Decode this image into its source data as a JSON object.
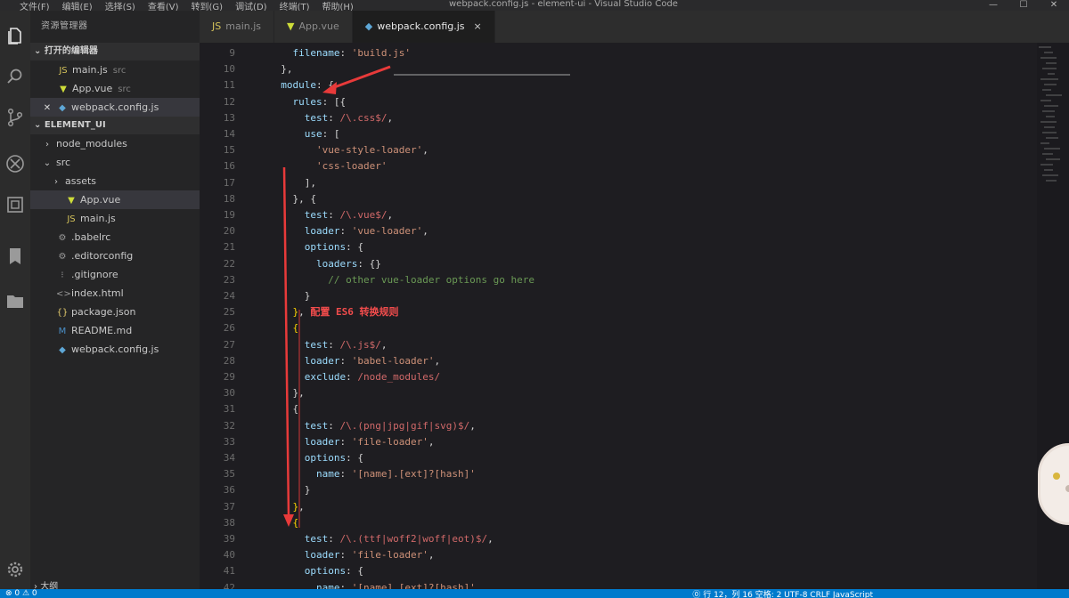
{
  "window": {
    "title": "webpack.config.js - element-ui - Visual Studio Code",
    "controls": [
      "—",
      "☐",
      "✕"
    ]
  },
  "menu": [
    "文件(F)",
    "编辑(E)",
    "选择(S)",
    "查看(V)",
    "转到(G)",
    "调试(D)",
    "终端(T)",
    "帮助(H)"
  ],
  "activity_bar": {
    "icons": [
      "files-icon",
      "search-icon",
      "source-control-icon",
      "debug-icon",
      "extensions-icon",
      "bookmark-icon",
      "folder-icon",
      "settings-gear-icon"
    ]
  },
  "sidebar": {
    "header": "资源管理器",
    "open_editors_title": "打开的编辑器",
    "open_editors": [
      {
        "icon": "JS",
        "label": "main.js",
        "hint": "src"
      },
      {
        "icon": "▼",
        "label": "App.vue",
        "hint": "src"
      },
      {
        "icon": "◆",
        "label": "webpack.config.js",
        "hint": ""
      }
    ],
    "project_title": "ELEMENT_UI",
    "tree": [
      {
        "label": "node_modules",
        "arrow": "›",
        "icon": ""
      },
      {
        "label": "src",
        "arrow": "⌄",
        "icon": ""
      },
      {
        "label": "assets",
        "arrow": "›",
        "icon": ""
      },
      {
        "label": "App.vue",
        "arrow": "",
        "icon": "▼"
      },
      {
        "label": "main.js",
        "arrow": "",
        "icon": "JS"
      },
      {
        "label": ".babelrc",
        "arrow": "",
        "icon": "⚙"
      },
      {
        "label": ".editorconfig",
        "arrow": "",
        "icon": "⚙"
      },
      {
        "label": ".gitignore",
        "arrow": "",
        "icon": "⁝"
      },
      {
        "label": "index.html",
        "arrow": "",
        "icon": "<>"
      },
      {
        "label": "package.json",
        "arrow": "",
        "icon": "{}"
      },
      {
        "label": "README.md",
        "arrow": "",
        "icon": "M"
      },
      {
        "label": "webpack.config.js",
        "arrow": "",
        "icon": "◆"
      }
    ],
    "outline": "大纲"
  },
  "tabs": [
    {
      "icon": "JS",
      "label": "main.js",
      "active": false
    },
    {
      "icon": "▼",
      "label": "App.vue",
      "active": false
    },
    {
      "icon": "◆",
      "label": "webpack.config.js",
      "active": true,
      "close": "×"
    }
  ],
  "editor": {
    "lines": [
      {
        "n": "9",
        "indent": "    ",
        "parts": [
          [
            "tk-key",
            "filename"
          ],
          [
            "",
            ": "
          ],
          [
            "tk-str",
            "'build.js'"
          ]
        ]
      },
      {
        "n": "10",
        "indent": "  ",
        "parts": [
          [
            "",
            "},"
          ]
        ]
      },
      {
        "n": "11",
        "indent": "  ",
        "parts": [
          [
            "tk-key",
            "module"
          ],
          [
            "",
            ": {"
          ]
        ]
      },
      {
        "n": "12",
        "indent": "    ",
        "parts": [
          [
            "tk-key",
            "rules"
          ],
          [
            "",
            ": [{"
          ]
        ]
      },
      {
        "n": "13",
        "indent": "      ",
        "parts": [
          [
            "tk-key",
            "test"
          ],
          [
            "",
            ": "
          ],
          [
            "tk-re",
            "/\\.css$/"
          ],
          [
            "",
            ","
          ]
        ]
      },
      {
        "n": "14",
        "indent": "      ",
        "parts": [
          [
            "tk-key",
            "use"
          ],
          [
            "",
            ": ["
          ]
        ]
      },
      {
        "n": "15",
        "indent": "        ",
        "parts": [
          [
            "tk-str",
            "'vue-style-loader'"
          ],
          [
            "",
            ","
          ]
        ]
      },
      {
        "n": "16",
        "indent": "        ",
        "parts": [
          [
            "tk-str",
            "'css-loader'"
          ]
        ]
      },
      {
        "n": "17",
        "indent": "      ",
        "parts": [
          [
            "",
            "],"
          ]
        ]
      },
      {
        "n": "18",
        "indent": "    ",
        "parts": [
          [
            "",
            "}, {"
          ]
        ]
      },
      {
        "n": "19",
        "indent": "      ",
        "parts": [
          [
            "tk-key",
            "test"
          ],
          [
            "",
            ": "
          ],
          [
            "tk-re",
            "/\\.vue$/"
          ],
          [
            "",
            ","
          ]
        ]
      },
      {
        "n": "20",
        "indent": "      ",
        "parts": [
          [
            "tk-key",
            "loader"
          ],
          [
            "",
            ": "
          ],
          [
            "tk-str",
            "'vue-loader'"
          ],
          [
            "",
            ","
          ]
        ]
      },
      {
        "n": "21",
        "indent": "      ",
        "parts": [
          [
            "tk-key",
            "options"
          ],
          [
            "",
            ": {"
          ]
        ]
      },
      {
        "n": "22",
        "indent": "        ",
        "parts": [
          [
            "tk-key",
            "loaders"
          ],
          [
            "",
            ": {}"
          ]
        ]
      },
      {
        "n": "23",
        "indent": "          ",
        "parts": [
          [
            "tk-cmt",
            "// other vue-loader options go here"
          ]
        ]
      },
      {
        "n": "24",
        "indent": "      ",
        "parts": [
          [
            "",
            "}"
          ]
        ]
      },
      {
        "n": "25",
        "indent": "    ",
        "parts": [
          [
            "tk-br",
            "}"
          ],
          [
            "",
            ", "
          ],
          [
            "tk-red",
            "配置 ES6 转换规则"
          ]
        ]
      },
      {
        "n": "26",
        "indent": "    ",
        "parts": [
          [
            "tk-br",
            "{"
          ]
        ]
      },
      {
        "n": "27",
        "indent": "      ",
        "parts": [
          [
            "tk-key",
            "test"
          ],
          [
            "",
            ": "
          ],
          [
            "tk-re",
            "/\\.js$/"
          ],
          [
            "",
            ","
          ]
        ]
      },
      {
        "n": "28",
        "indent": "      ",
        "parts": [
          [
            "tk-key",
            "loader"
          ],
          [
            "",
            ": "
          ],
          [
            "tk-str",
            "'babel-loader'"
          ],
          [
            "",
            ","
          ]
        ]
      },
      {
        "n": "29",
        "indent": "      ",
        "parts": [
          [
            "tk-key",
            "exclude"
          ],
          [
            "",
            ": "
          ],
          [
            "tk-re",
            "/node_modules/"
          ]
        ]
      },
      {
        "n": "30",
        "indent": "    ",
        "parts": [
          [
            "",
            "},"
          ]
        ]
      },
      {
        "n": "31",
        "indent": "    ",
        "parts": [
          [
            "",
            "{"
          ]
        ]
      },
      {
        "n": "32",
        "indent": "      ",
        "parts": [
          [
            "tk-key",
            "test"
          ],
          [
            "",
            ": "
          ],
          [
            "tk-re",
            "/\\.(png|jpg|gif|svg)$/"
          ],
          [
            "",
            ","
          ]
        ]
      },
      {
        "n": "33",
        "indent": "      ",
        "parts": [
          [
            "tk-key",
            "loader"
          ],
          [
            "",
            ": "
          ],
          [
            "tk-str",
            "'file-loader'"
          ],
          [
            "",
            ","
          ]
        ]
      },
      {
        "n": "34",
        "indent": "      ",
        "parts": [
          [
            "tk-key",
            "options"
          ],
          [
            "",
            ": {"
          ]
        ]
      },
      {
        "n": "35",
        "indent": "        ",
        "parts": [
          [
            "tk-key",
            "name"
          ],
          [
            "",
            ": "
          ],
          [
            "tk-str",
            "'[name].[ext]?[hash]'"
          ]
        ]
      },
      {
        "n": "36",
        "indent": "      ",
        "parts": [
          [
            "",
            "}"
          ]
        ]
      },
      {
        "n": "37",
        "indent": "    ",
        "parts": [
          [
            "tk-br",
            "}"
          ],
          [
            "",
            ","
          ]
        ]
      },
      {
        "n": "38",
        "indent": "    ",
        "parts": [
          [
            "tk-br",
            "{"
          ]
        ]
      },
      {
        "n": "39",
        "indent": "      ",
        "parts": [
          [
            "tk-key",
            "test"
          ],
          [
            "",
            ": "
          ],
          [
            "tk-re",
            "/\\.(ttf|woff2|woff|eot)$/"
          ],
          [
            "",
            ","
          ]
        ]
      },
      {
        "n": "40",
        "indent": "      ",
        "parts": [
          [
            "tk-key",
            "loader"
          ],
          [
            "",
            ": "
          ],
          [
            "tk-str",
            "'file-loader'"
          ],
          [
            "",
            ","
          ]
        ]
      },
      {
        "n": "41",
        "indent": "      ",
        "parts": [
          [
            "tk-key",
            "options"
          ],
          [
            "",
            ": {"
          ]
        ]
      },
      {
        "n": "42",
        "indent": "        ",
        "parts": [
          [
            "tk-key",
            "name"
          ],
          [
            "",
            ": "
          ],
          [
            "tk-str",
            "'[name].[ext]?[hash]'"
          ]
        ]
      }
    ]
  },
  "statusbar": {
    "left": "⊗ 0  ⚠ 0",
    "right": "⓪ 行 12，列 16  空格: 2  UTF-8  CRLF  JavaScript"
  },
  "colors": {
    "accent": "#007acc",
    "annotation": "#e83a3a"
  }
}
